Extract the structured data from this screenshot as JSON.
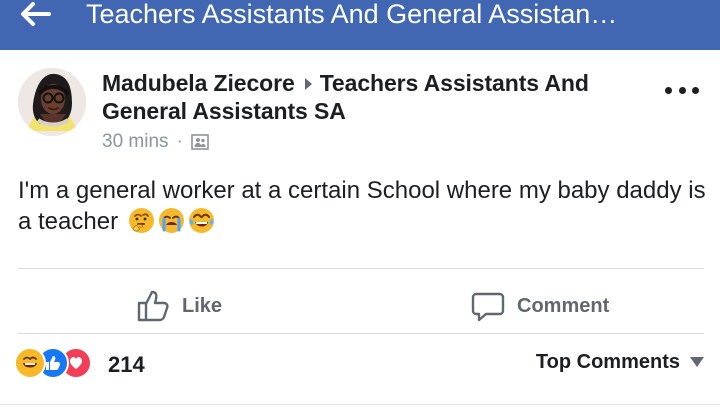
{
  "app": {
    "header_title": "Teachers Assistants And General Assistan…",
    "back_icon": "arrow-left-icon"
  },
  "post": {
    "author": "Madubela Ziecore",
    "group": "Teachers Assistants And General Assistants SA",
    "time": "30 mins",
    "separator": "·",
    "privacy_icon": "group-icon",
    "text": "I'm a general worker at a certain School where my baby daddy is a teacher",
    "emojis": [
      "thinking-face-icon",
      "crying-face-icon",
      "tears-of-joy-icon"
    ],
    "more_icon": "more-options-icon"
  },
  "actions": {
    "like": "Like",
    "comment": "Comment"
  },
  "summary": {
    "reaction_count": "214",
    "reactions": [
      "laugh-reaction-icon",
      "like-reaction-icon",
      "love-reaction-icon"
    ],
    "top_comments": "Top Comments"
  },
  "colors": {
    "header_blue": "#4267b2",
    "text_dark": "#1c1e21",
    "muted": "#606770",
    "secondary": "#8d949e",
    "divider": "#dadde1"
  }
}
